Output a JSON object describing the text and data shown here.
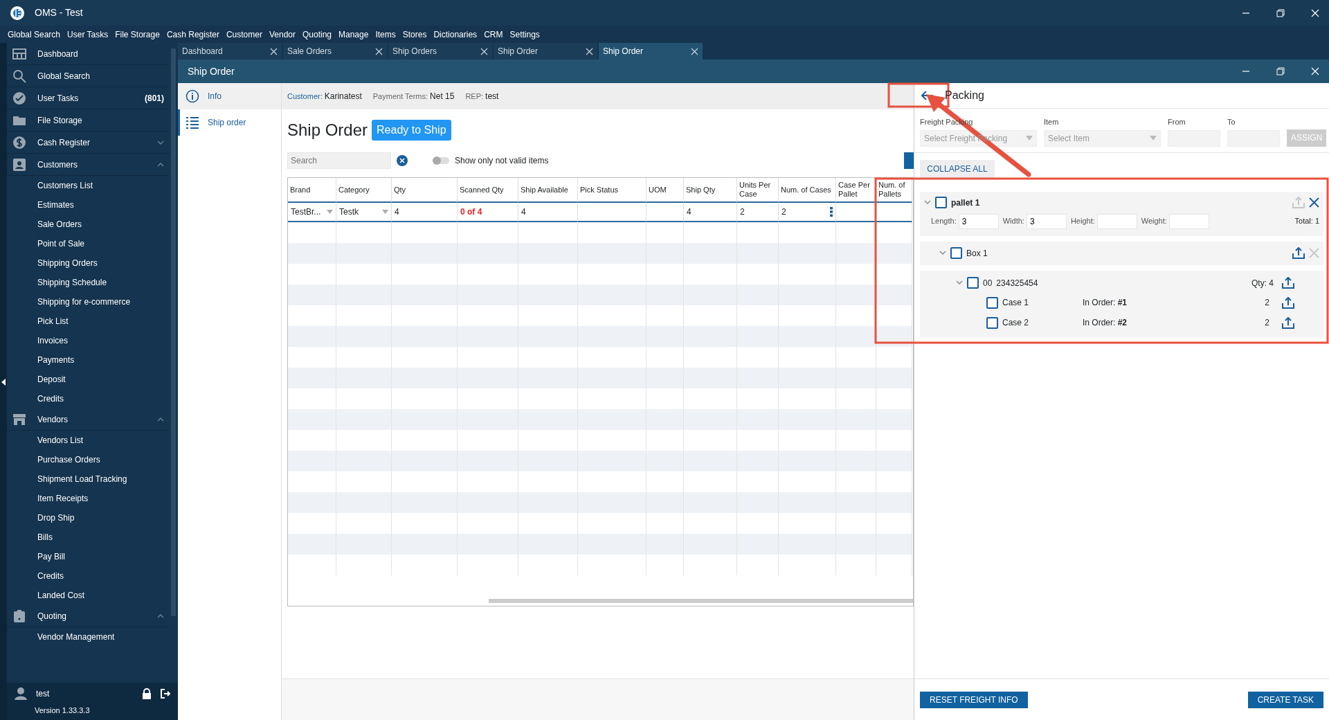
{
  "window": {
    "title": "OMS - Test"
  },
  "menu": [
    "Global Search",
    "User Tasks",
    "File Storage",
    "Cash Register",
    "Customer",
    "Vendor",
    "Quoting",
    "Manage",
    "Items",
    "Stores",
    "Dictionaries",
    "CRM",
    "Settings"
  ],
  "sidebar": {
    "items": [
      {
        "label": "Dashboard"
      },
      {
        "label": "Global Search"
      },
      {
        "label": "User Tasks",
        "badge": "(801)"
      },
      {
        "label": "File Storage"
      },
      {
        "label": "Cash Register",
        "expanded": false
      },
      {
        "label": "Customers",
        "expanded": true,
        "children": [
          {
            "label": "Customers List"
          },
          {
            "label": "Estimates"
          },
          {
            "label": "Sale Orders"
          },
          {
            "label": "Point of Sale"
          },
          {
            "label": "Shipping Orders"
          },
          {
            "label": "Shipping Schedule"
          },
          {
            "label": "Shipping for e-commerce"
          },
          {
            "label": "Pick List"
          },
          {
            "label": "Invoices"
          },
          {
            "label": "Payments"
          },
          {
            "label": "Deposit"
          },
          {
            "label": "Credits"
          }
        ]
      },
      {
        "label": "Vendors",
        "expanded": true,
        "children": [
          {
            "label": "Vendors List"
          },
          {
            "label": "Purchase Orders"
          },
          {
            "label": "Shipment Load Tracking"
          },
          {
            "label": "Item Receipts"
          },
          {
            "label": "Drop Ship"
          },
          {
            "label": "Bills"
          },
          {
            "label": "Pay Bill"
          },
          {
            "label": "Credits"
          },
          {
            "label": "Landed Cost"
          }
        ]
      },
      {
        "label": "Quoting",
        "expanded": true,
        "children": [
          {
            "label": "Vendor Management"
          }
        ]
      }
    ],
    "user": "test",
    "version": "Version 1.33.3.3"
  },
  "tabs": [
    {
      "label": "Dashboard",
      "selected": false
    },
    {
      "label": "Sale Orders",
      "selected": false
    },
    {
      "label": "Ship Orders",
      "selected": false
    },
    {
      "label": "Ship Order",
      "selected": false
    },
    {
      "label": "Ship Order",
      "selected": true
    }
  ],
  "inner_window": {
    "title": "Ship Order"
  },
  "left_nav": [
    {
      "label": "Info",
      "selected": false
    },
    {
      "label": "Ship order",
      "selected": true
    }
  ],
  "info_bar": [
    {
      "label": "Customer:",
      "value": "Karinatest",
      "accent": true
    },
    {
      "label": "Payment Terms:",
      "value": "Net 15",
      "accent": false
    },
    {
      "label": "REP:",
      "value": "test",
      "accent": false
    }
  ],
  "heading": "Ship Order",
  "status": "Ready to Ship",
  "search": {
    "placeholder": "Search"
  },
  "toggle": {
    "label": "Show only not valid items",
    "on": false
  },
  "table": {
    "columns": [
      "Brand",
      "Category",
      "Qty",
      "Scanned Qty",
      "Ship Available",
      "Pick Status",
      "UOM",
      "Ship Qty",
      "Units Per Case",
      "Num. of Cases",
      "Case Per Pallet",
      "Num. of Pallets"
    ],
    "rows": [
      {
        "cells": [
          {
            "text": "TestBr...",
            "kind": "select"
          },
          {
            "text": "Testk",
            "kind": "select"
          },
          {
            "text": "4",
            "kind": "plain"
          },
          {
            "text": "0 of 4",
            "kind": "alert"
          },
          {
            "text": "4",
            "kind": "plain"
          },
          {
            "kind": "plain"
          },
          {
            "kind": "plain"
          },
          {
            "text": "4",
            "kind": "plain"
          },
          {
            "text": "2",
            "kind": "plain"
          },
          {
            "text": "2",
            "kind": "menu"
          },
          {
            "kind": "plain"
          },
          {
            "kind": "plain"
          }
        ]
      }
    ]
  },
  "packing": {
    "title": "Packing",
    "filters": [
      {
        "label": "Freight Packing",
        "placeholder": "Select Freight Packing",
        "kind": "select"
      },
      {
        "label": "Item",
        "placeholder": "Select Item",
        "kind": "select"
      },
      {
        "label": "From",
        "kind": "input"
      },
      {
        "label": "To",
        "kind": "input"
      }
    ],
    "assign": {
      "label": "ASSIGN",
      "disabled": true
    },
    "collapse": "COLLAPSE ALL",
    "tree": [
      {
        "kind": "pallet",
        "label": "pallet 1",
        "checked": false,
        "expanded": true,
        "upload_disabled": true,
        "remove_disabled": false,
        "dims": [
          {
            "label": "Length:",
            "value": "3"
          },
          {
            "label": "Width:",
            "value": "3"
          },
          {
            "label": "Height:"
          },
          {
            "label": "Weight:"
          }
        ],
        "total": "Total: 1",
        "children": [
          {
            "kind": "box",
            "label": "Box 1",
            "checked": false,
            "expanded": true,
            "upload_disabled": false,
            "remove_disabled": true,
            "children": [
              {
                "kind": "item",
                "code": "00",
                "label": "234325454",
                "qty": "Qty: 4",
                "checked": false,
                "expanded": true,
                "children": [
                  {
                    "kind": "case",
                    "label": "Case 1",
                    "order": "In Order: **#1**",
                    "qty": "2",
                    "checked": false
                  },
                  {
                    "kind": "case",
                    "label": "Case 2",
                    "order": "In Order: **#2**",
                    "qty": "2",
                    "checked": false
                  }
                ]
              }
            ]
          }
        ]
      }
    ],
    "buttons": [
      "RESET FREIGHT INFO",
      "CREATE TASK"
    ]
  }
}
